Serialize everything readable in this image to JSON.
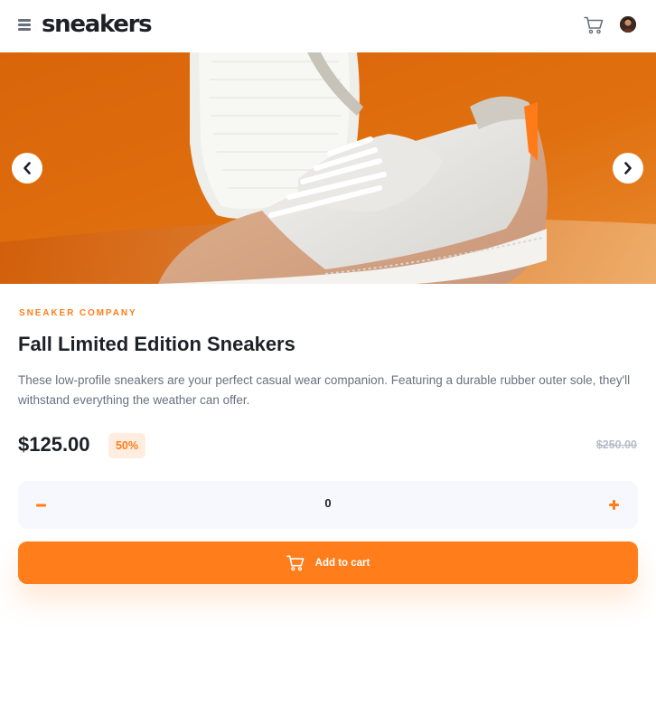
{
  "header": {
    "logo": "sneakers",
    "menu_icon": "hamburger-menu-icon",
    "cart_icon": "cart-icon",
    "avatar": "user-avatar"
  },
  "carousel": {
    "prev_icon": "chevron-left-icon",
    "next_icon": "chevron-right-icon",
    "image": "white-beige sneaker on orange background"
  },
  "product": {
    "company": "Sneaker Company",
    "title": "Fall Limited Edition Sneakers",
    "description": "These low-profile sneakers are your perfect casual wear companion. Featuring a durable rubber outer sole, they'll withstand everything the weather can offer.",
    "price": "$125.00",
    "discount": "50%",
    "original_price": "$250.00"
  },
  "quantity": {
    "value": "0",
    "minus_icon": "minus-icon",
    "plus_icon": "plus-icon"
  },
  "cart_button": {
    "label": "Add to cart",
    "icon": "cart-icon"
  },
  "colors": {
    "accent": "#ff7e1b",
    "accent_pale": "#ffede0",
    "text_dark": "#1d2026",
    "text_muted": "#69707d",
    "text_light": "#b6bcc8",
    "qty_bg": "#f6f8fd"
  }
}
